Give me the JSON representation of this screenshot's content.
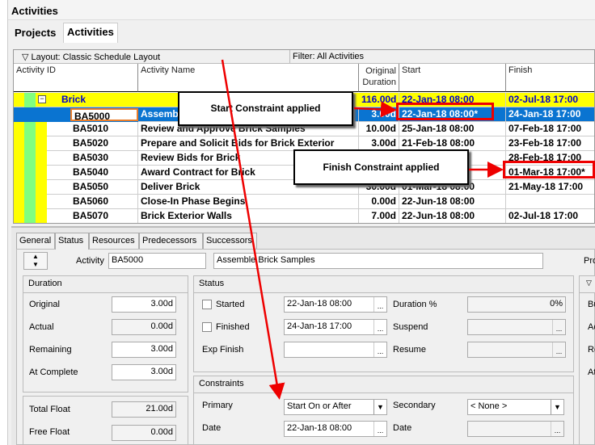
{
  "window": {
    "title": "Activities"
  },
  "top_tabs": [
    "Projects",
    "Activities"
  ],
  "grid": {
    "layout_label": "Layout: Classic Schedule Layout",
    "filter_label": "Filter: All Activities",
    "columns": [
      "Activity ID",
      "Activity Name",
      "Original Duration",
      "Start",
      "Finish"
    ],
    "group": {
      "name": "Brick",
      "duration": "116.00d",
      "start": "22-Jan-18 08:00",
      "finish": "02-Jul-18 17:00"
    },
    "rows": [
      {
        "id": "BA5000",
        "name": "Assemble Brick Samples",
        "duration": "3.00d",
        "start": "22-Jan-18 08:00*",
        "finish": "24-Jan-18 17:00"
      },
      {
        "id": "BA5010",
        "name": "Review and Approve Brick Samples",
        "duration": "10.00d",
        "start": "25-Jan-18 08:00",
        "finish": "07-Feb-18 17:00"
      },
      {
        "id": "BA5020",
        "name": "Prepare and Solicit Bids for Brick Exterior",
        "duration": "3.00d",
        "start": "21-Feb-18 08:00",
        "finish": "23-Feb-18 17:00"
      },
      {
        "id": "BA5030",
        "name": "Review Bids for Brick",
        "duration": "",
        "start": "",
        "finish": "28-Feb-18 17:00"
      },
      {
        "id": "BA5040",
        "name": "Award Contract for Brick",
        "duration": "",
        "start": "",
        "finish": "01-Mar-18 17:00*"
      },
      {
        "id": "BA5050",
        "name": "Deliver Brick",
        "duration": "30.00d",
        "start": "01-Mar-18 08:00",
        "finish": "21-May-18 17:00"
      },
      {
        "id": "BA5060",
        "name": "Close-In Phase Begins",
        "duration": "0.00d",
        "start": "22-Jun-18 08:00",
        "finish": ""
      },
      {
        "id": "BA5070",
        "name": "Brick Exterior Walls",
        "duration": "7.00d",
        "start": "22-Jun-18 08:00",
        "finish": "02-Jul-18 17:00"
      }
    ]
  },
  "callouts": {
    "start": "Start Constraint applied",
    "finish": "Finish Constraint applied"
  },
  "details": {
    "tabs": [
      "General",
      "Status",
      "Resources",
      "Predecessors",
      "Successors"
    ],
    "active_tab": "Status",
    "activity_label": "Activity",
    "activity_id": "BA5000",
    "activity_name": "Assemble Brick Samples",
    "pro_label": "Pro",
    "duration": {
      "title": "Duration",
      "original_label": "Original",
      "original": "3.00d",
      "actual_label": "Actual",
      "actual": "0.00d",
      "remaining_label": "Remaining",
      "remaining": "3.00d",
      "at_complete_label": "At Complete",
      "at_complete": "3.00d"
    },
    "float": {
      "total_label": "Total Float",
      "total": "21.00d",
      "free_label": "Free Float",
      "free": "0.00d"
    },
    "status": {
      "title": "Status",
      "started_label": "Started",
      "started": "22-Jan-18 08:00",
      "started_checked": false,
      "finished_label": "Finished",
      "finished": "24-Jan-18 17:00",
      "finished_checked": false,
      "exp_finish_label": "Exp Finish",
      "exp_finish": "",
      "duration_pct_label": "Duration %",
      "duration_pct": "0%",
      "suspend_label": "Suspend",
      "resume_label": "Resume"
    },
    "constraints": {
      "title": "Constraints",
      "primary_label": "Primary",
      "primary": "Start On or After",
      "primary_date_label": "Date",
      "primary_date": "22-Jan-18 08:00",
      "secondary_label": "Secondary",
      "secondary": "< None >",
      "secondary_date_label": "Date"
    },
    "right_labels": [
      "Bu",
      "Ac",
      "Re",
      "At"
    ]
  },
  "colors": {
    "group_row": "#ffff00",
    "selected_row": "#0a74d1",
    "band_green": "#80ff80",
    "annotation_red": "#e00000",
    "group_text": "#0000cc"
  }
}
